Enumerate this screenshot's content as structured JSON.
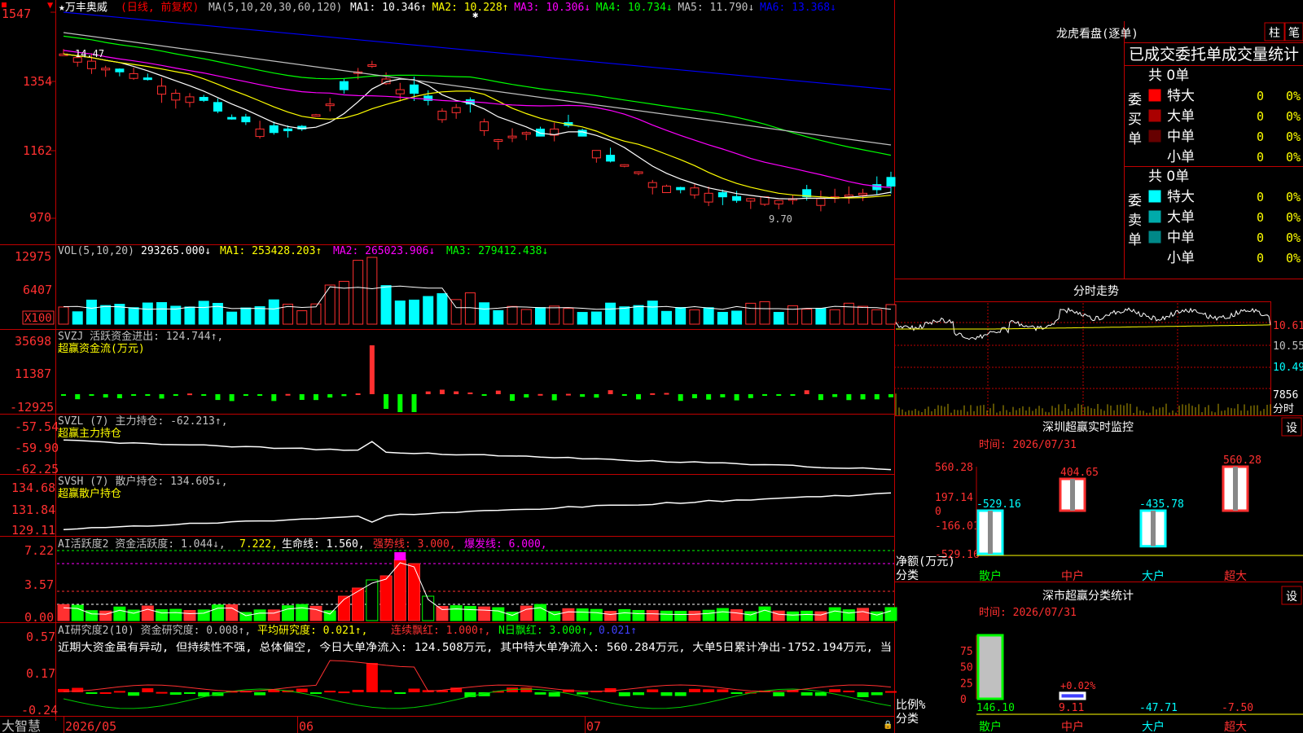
{
  "app": {
    "brand": "大智慧",
    "security": "★万丰奥威",
    "period": "(日线, 前复权)",
    "ma_header": "MA(5,10,20,30,60,120)"
  },
  "panels": {
    "price": {
      "yticks": [
        "1547",
        "1354",
        "1162",
        "970"
      ],
      "ma_labels": [
        {
          "text": "MA1: 10.346↑",
          "color": "#ffffff"
        },
        {
          "text": "MA2: 10.228↑",
          "color": "#ffff00"
        },
        {
          "text": "MA3: 10.306↓",
          "color": "#ff00ff"
        },
        {
          "text": "MA4: 10.734↓",
          "color": "#00ff00"
        },
        {
          "text": "MA5: 11.790↓",
          "color": "#c0c0c0"
        },
        {
          "text": "MA6: 13.368↓",
          "color": "#0000ff"
        }
      ],
      "high_marker": "14.47",
      "low_marker": "9.70"
    },
    "volume": {
      "header": "VOL(5,10,20)",
      "value": "293265.000↓",
      "ma1": "MA1: 253428.203↑",
      "ma2": "MA2: 265023.906↓",
      "ma3": "MA3: 279412.438↓",
      "yticks": [
        "12975",
        "6407"
      ],
      "unit": "X100"
    },
    "svzj": {
      "header": "SVZJ  活跃资金进出: 124.744↑,",
      "sub": "超赢资金流(万元)",
      "yticks": [
        "35698",
        "11387",
        "-12925"
      ]
    },
    "svzl": {
      "header": "SVZL (7) 主力持仓: -62.213↑,",
      "sub": "超赢主力持仓",
      "yticks": [
        "-57.54",
        "-59.90",
        "-62.25"
      ]
    },
    "svsh": {
      "header": "SVSH (7) 散户持仓: 134.605↓,",
      "sub": "超赢散户持仓",
      "yticks": [
        "134.68",
        "131.84",
        "129.11"
      ]
    },
    "ai_active": {
      "h1": "AI活跃度2 资金活跃度: 1.044↓,",
      "h2": "7.222,",
      "h3": "生命线: 1.560,",
      "h4": "强势线: 3.000,",
      "h5": "爆发线: 6.000,",
      "yticks": [
        "7.22",
        "3.57",
        "0.00"
      ]
    },
    "ai_research": {
      "h1": "AI研究度2(10) 资金研究度: 0.008↑,",
      "h2": "平均研究度: 0.021↑,",
      "h3": "连续飘红: 1.000↑,",
      "h4": "N日飘红: 3.000↑,",
      "h5": "0.021↑",
      "comment": "近期大资金虽有异动, 但持续性不强, 总体偏空, 今日大单净流入: 124.508万元, 其中特大单净流入: 560.284万元, 大单5日累计净出-1752.194万元, 当",
      "yticks": [
        "0.57",
        "0.17",
        "-0.24"
      ]
    }
  },
  "xaxis": [
    "2026/05",
    "06",
    "07"
  ],
  "right": {
    "lhkp_title": "龙虎看盘(逐单)",
    "btn_zhu": "柱",
    "btn_bi": "笔",
    "table_header": "已成交委托单成交量统计",
    "buy_label": "委买单",
    "sell_label": "委卖单",
    "buy_total": "共 0单",
    "sell_total": "共 0单",
    "buy_rows": [
      {
        "name": "特大",
        "v": "0",
        "p": "0%",
        "color": "#ff0000"
      },
      {
        "name": "大单",
        "v": "0",
        "p": "0%",
        "color": "#aa0000"
      },
      {
        "name": "中单",
        "v": "0",
        "p": "0%",
        "color": "#660000"
      },
      {
        "name": "小单",
        "v": "0",
        "p": "0%",
        "color": "#000000"
      }
    ],
    "sell_rows": [
      {
        "name": "特大",
        "v": "0",
        "p": "0%",
        "color": "#00ffff"
      },
      {
        "name": "大单",
        "v": "0",
        "p": "0%",
        "color": "#00aaaa"
      },
      {
        "name": "中单",
        "v": "0",
        "p": "0%",
        "color": "#008888"
      },
      {
        "name": "小单",
        "v": "0",
        "p": "0%",
        "color": "#000000"
      }
    ],
    "intraday_title": "分时走势",
    "intraday_yticks": [
      "10.61",
      "10.55",
      "10.49"
    ],
    "intraday_vol": "7856",
    "intraday_vol_label": "分时",
    "monitor_title": "深圳超赢实时监控",
    "monitor_time": "时间: 2026/07/31",
    "monitor_btn": "设",
    "monitor_yticks": [
      "560.28",
      "197.14",
      "0",
      "-166.01",
      "-529.16"
    ],
    "monitor_ylabel": "净额(万元)",
    "monitor_xlabel": "分类",
    "classify_title": "深市超赢分类统计",
    "classify_time": "时间: 2026/07/31",
    "classify_btn": "设",
    "classify_yticks": [
      "75",
      "50",
      "25",
      "0"
    ],
    "classify_ylabel": "比例%",
    "classify_xlabel": "分类",
    "classify_note": "+0.02%"
  },
  "chart_data": [
    {
      "type": "bar",
      "title": "深圳超赢实时监控",
      "ylabel": "净额(万元)",
      "categories": [
        "散户",
        "中户",
        "大户",
        "超大"
      ],
      "values": [
        -529.16,
        404.65,
        -435.78,
        560.28
      ],
      "labels": [
        "-529.16",
        "404.65",
        "-435.78",
        "560.28"
      ],
      "ylim": [
        -529.16,
        560.28
      ]
    },
    {
      "type": "bar",
      "title": "深市超赢分类统计",
      "ylabel": "比例%",
      "categories": [
        "散户",
        "中户",
        "大户",
        "超大"
      ],
      "values": [
        146.1,
        9.11,
        -47.71,
        -7.5
      ],
      "labels": [
        "146.10",
        "9.11",
        "-47.71",
        "-7.50"
      ],
      "ylim": [
        0,
        75
      ]
    },
    {
      "type": "line",
      "title": "MA",
      "series": [
        {
          "name": "MA6",
          "values": [
            15.4,
            14.1
          ]
        },
        {
          "name": "MA5",
          "values": [
            14.6,
            12.0
          ]
        }
      ]
    }
  ]
}
